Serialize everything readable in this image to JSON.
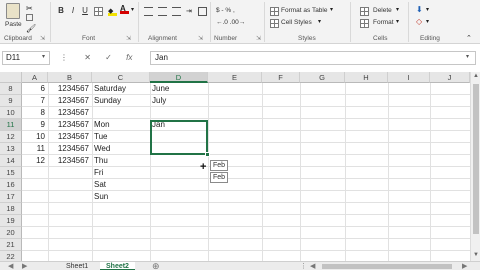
{
  "ribbon": {
    "clipboard_label": "Clipboard",
    "paste_label": "Paste",
    "font_label": "Font",
    "alignment_label": "Alignment",
    "number_label": "Number",
    "styles_label": "Styles",
    "cells_label": "Cells",
    "editing_label": "Editing",
    "bold": "B",
    "italic": "I",
    "underline": "U",
    "number_format": "$ - % ,",
    "format_as_table": "Format as Table",
    "cell_styles": "Cell Styles",
    "delete": "Delete",
    "format": "Format",
    "accent_color": "#217346"
  },
  "formula_bar": {
    "name_box": "D11",
    "fx": "fx",
    "content": "Jan"
  },
  "columns": [
    "A",
    "B",
    "C",
    "D",
    "E",
    "F",
    "G",
    "H",
    "I",
    "J"
  ],
  "selected_column": "D",
  "rows": [
    {
      "num": "8",
      "a": "6",
      "b": "1234567",
      "c": "Saturday",
      "d": "June"
    },
    {
      "num": "9",
      "a": "7",
      "b": "1234567",
      "c": "Sunday",
      "d": "July"
    },
    {
      "num": "10",
      "a": "8",
      "b": "1234567",
      "c": "",
      "d": ""
    },
    {
      "num": "11",
      "a": "9",
      "b": "1234567",
      "c": "Mon",
      "d": "Jan"
    },
    {
      "num": "12",
      "a": "10",
      "b": "1234567",
      "c": "Tue",
      "d": ""
    },
    {
      "num": "13",
      "a": "11",
      "b": "1234567",
      "c": "Wed",
      "d": ""
    },
    {
      "num": "14",
      "a": "12",
      "b": "1234567",
      "c": "Thu",
      "d": ""
    },
    {
      "num": "15",
      "a": "",
      "b": "",
      "c": "Fri",
      "d": ""
    },
    {
      "num": "16",
      "a": "",
      "b": "",
      "c": "Sat",
      "d": ""
    },
    {
      "num": "17",
      "a": "",
      "b": "",
      "c": "Sun",
      "d": ""
    },
    {
      "num": "18",
      "a": "",
      "b": "",
      "c": "",
      "d": ""
    },
    {
      "num": "19",
      "a": "",
      "b": "",
      "c": "",
      "d": ""
    },
    {
      "num": "20",
      "a": "",
      "b": "",
      "c": "",
      "d": ""
    },
    {
      "num": "21",
      "a": "",
      "b": "",
      "c": "",
      "d": ""
    },
    {
      "num": "22",
      "a": "",
      "b": "",
      "c": "",
      "d": ""
    }
  ],
  "selected_row": "11",
  "autofill_tooltips": [
    "Feb",
    "Feb"
  ],
  "sheets": {
    "tab1": "Sheet1",
    "tab2": "Sheet2",
    "active": "Sheet2"
  }
}
